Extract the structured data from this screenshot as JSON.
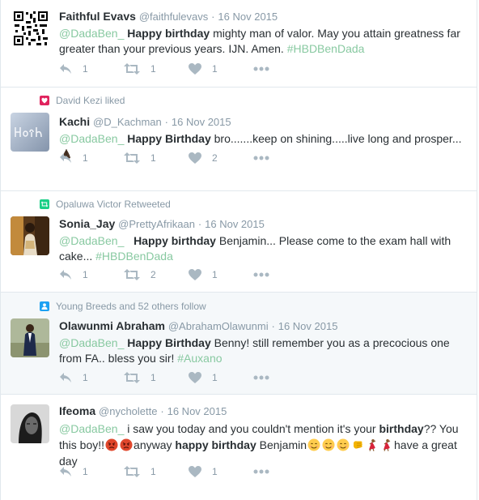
{
  "tweets": [
    {
      "context": "",
      "fullname": "Faithful Evavs",
      "username": "@faithfulevavs",
      "time": "16 Nov 2015",
      "text": [
        {
          "t": "@DadaBen_",
          "c": "mention"
        },
        {
          "t": " "
        },
        {
          "t": "Happy birthday",
          "c": "b"
        },
        {
          "t": " mighty man of valor. May you attain greatness far greater than your previous years. IJN. Amen. "
        },
        {
          "t": "#HBDBenDada",
          "c": "hashtag"
        }
      ],
      "reply_count": "1",
      "retweet_count": "1",
      "like_count": "1"
    },
    {
      "context": "David Kezi liked",
      "fullname": "Kachi",
      "username": "@D_Kachman",
      "time": "16 Nov 2015",
      "text": [
        {
          "t": "@DadaBen_",
          "c": "mention"
        },
        {
          "t": "  "
        },
        {
          "t": "Happy Birthday",
          "c": "b"
        },
        {
          "t": " bro.......keep on shining.....live long and prosper..."
        }
      ],
      "reply_count": "1",
      "retweet_count": "1",
      "like_count": "2"
    },
    {
      "context": "Opaluwa Victor Retweeted",
      "fullname": "Sonia_Jay",
      "username": "@PrettyAfrikaan",
      "time": "16 Nov 2015",
      "text": [
        {
          "t": "@DadaBen_",
          "c": "mention"
        },
        {
          "t": "   "
        },
        {
          "t": "Happy birthday",
          "c": "b"
        },
        {
          "t": " Benjamin... Please come to the exam hall with cake... "
        },
        {
          "t": "#HBDBenDada",
          "c": "hashtag"
        }
      ],
      "reply_count": "1",
      "retweet_count": "2",
      "like_count": "1"
    },
    {
      "context": "Young Breeds and 52 others follow",
      "fullname": "Olawunmi Abraham",
      "username": "@AbrahamOlawunmi",
      "time": "16 Nov 2015",
      "text": [
        {
          "t": "@DadaBen_",
          "c": "mention"
        },
        {
          "t": "  "
        },
        {
          "t": "Happy Birthday",
          "c": "b"
        },
        {
          "t": " Benny! still remember you as a precocious one from FA.. bless you sir! "
        },
        {
          "t": "#Auxano",
          "c": "hashtag"
        }
      ],
      "reply_count": "1",
      "retweet_count": "1",
      "like_count": "1"
    },
    {
      "context": "",
      "fullname": "Ifeoma",
      "username": "@nycholette",
      "time": "16 Nov 2015",
      "text": [
        {
          "t": "@DadaBen_",
          "c": "mention"
        },
        {
          "t": " i saw you today and you couldn't mention it's your "
        },
        {
          "t": "birthday",
          "c": "b"
        },
        {
          "t": "?? You this boy!!"
        },
        {
          "t": "anyway "
        },
        {
          "t": "happy birthday",
          "c": "b"
        },
        {
          "t": " Benjamin"
        },
        {
          "t": "have a great day"
        }
      ],
      "reply_count": "1",
      "retweet_count": "1",
      "like_count": "1"
    }
  ],
  "icons": {
    "reply": "reply-icon",
    "retweet": "retweet-icon",
    "like": "heart-icon",
    "more": "more-dots-icon"
  },
  "colors": {
    "link": "#88c9a1",
    "muted": "#8899a6",
    "text": "#292f33",
    "like_context": "#e0245e",
    "retweet_context": "#19cf86",
    "follow_context": "#1da1f2",
    "highlight_bg": "#f5f8fa"
  }
}
